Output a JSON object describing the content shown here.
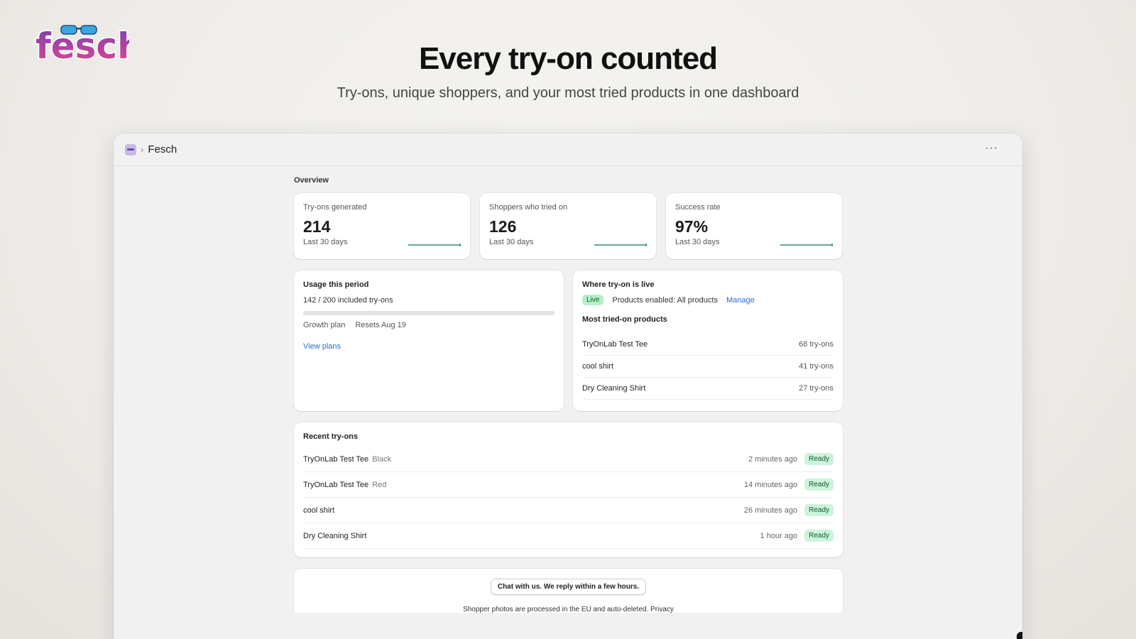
{
  "brand": {
    "logo_text": "fesch"
  },
  "hero": {
    "title": "Every try-on counted",
    "subtitle": "Try-ons, unique shoppers, and your most tried products in one dashboard"
  },
  "window": {
    "app_name": "Fesch",
    "more_label": "···"
  },
  "overview": {
    "label": "Overview",
    "metrics": [
      {
        "label": "Try-ons generated",
        "value": "214",
        "period": "Last 30 days"
      },
      {
        "label": "Shoppers who tried on",
        "value": "126",
        "period": "Last 30 days"
      },
      {
        "label": "Success rate",
        "value": "97%",
        "period": "Last 30 days"
      }
    ]
  },
  "usage": {
    "title": "Usage this period",
    "count": "142 / 200 included try-ons",
    "used": 142,
    "limit": 200,
    "plan": "Growth plan",
    "resets": "Resets Aug 19",
    "view_plans": "View plans"
  },
  "live": {
    "title": "Where try-on is live",
    "status": "Live",
    "products_enabled": "Products enabled: All products",
    "manage": "Manage",
    "most_title": "Most tried-on products",
    "products": [
      {
        "name": "TryOnLab Test Tee",
        "count": "68 try-ons"
      },
      {
        "name": "cool shirt",
        "count": "41 try-ons"
      },
      {
        "name": "Dry Cleaning Shirt",
        "count": "27 try-ons"
      }
    ]
  },
  "recent": {
    "title": "Recent try-ons",
    "items": [
      {
        "name": "TryOnLab Test Tee",
        "variant": "Black",
        "time": "2 minutes ago",
        "status": "Ready"
      },
      {
        "name": "TryOnLab Test Tee",
        "variant": "Red",
        "time": "14 minutes ago",
        "status": "Ready"
      },
      {
        "name": "cool shirt",
        "variant": "",
        "time": "26 minutes ago",
        "status": "Ready"
      },
      {
        "name": "Dry Cleaning Shirt",
        "variant": "",
        "time": "1 hour ago",
        "status": "Ready"
      }
    ]
  },
  "footer": {
    "chat": "Chat with us. We reply within a few hours.",
    "privacy": "Shopper photos are processed in the EU and auto-deleted. Privacy"
  },
  "colors": {
    "accent_link": "#2c6ecb",
    "sparkline": "#2f8f7a",
    "badge_green": "#cdf3dc"
  }
}
